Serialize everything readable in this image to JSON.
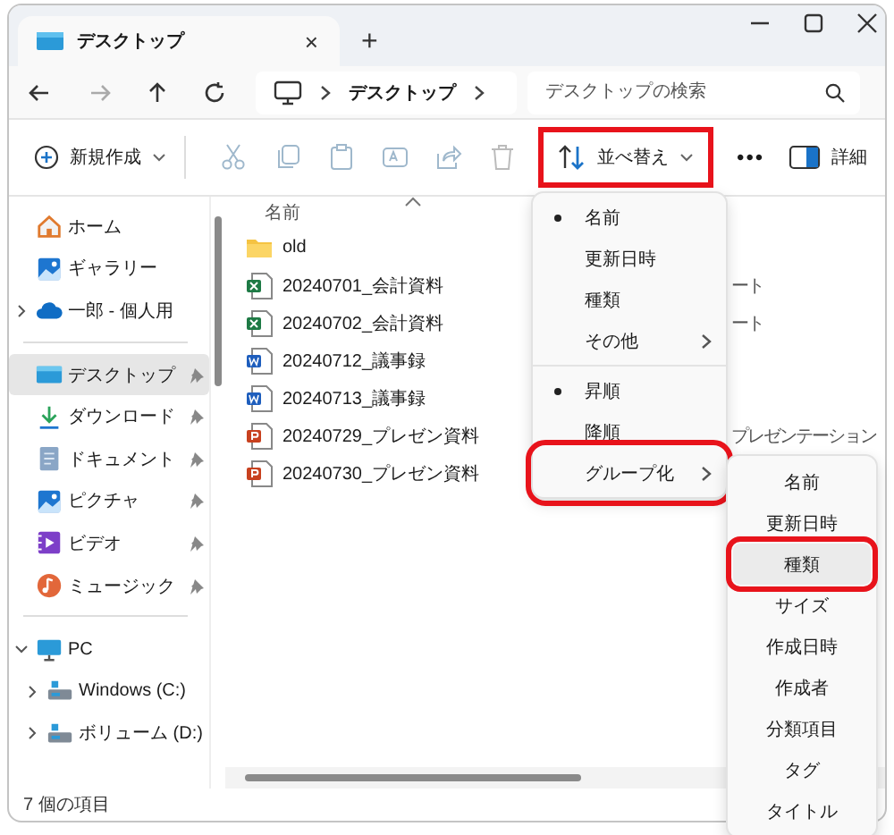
{
  "window": {
    "tab_title": "デスクトップ",
    "tab_close": "×",
    "new_tab": "+"
  },
  "nav": {
    "address": "デスクトップ",
    "search": {
      "placeholder": "デスクトップの検索"
    }
  },
  "toolbar": {
    "new": {
      "label": "新規作成"
    },
    "sort": {
      "label": "並べ替え",
      "highlighted": true
    },
    "more": "•••",
    "details": {
      "label": "詳細"
    }
  },
  "sidebar": {
    "groups": [
      {
        "items": [
          {
            "label": "ホーム",
            "kind": "home",
            "selected": false
          },
          {
            "label": "ギャラリー",
            "kind": "gallery",
            "selected": false
          },
          {
            "label": "一郎 - 個人用",
            "kind": "cloud",
            "selected": false,
            "expanded": false
          }
        ]
      },
      {
        "items": [
          {
            "label": "デスクトップ",
            "kind": "desktop",
            "selected": true,
            "pinned": true
          },
          {
            "label": "ダウンロード",
            "kind": "download",
            "selected": false,
            "pinned": true
          },
          {
            "label": "ドキュメント",
            "kind": "document",
            "selected": false,
            "pinned": true
          },
          {
            "label": "ピクチャ",
            "kind": "gallery",
            "selected": false,
            "pinned": true
          },
          {
            "label": "ビデオ",
            "kind": "video",
            "selected": false,
            "pinned": true
          },
          {
            "label": "ミュージック",
            "kind": "music",
            "selected": false,
            "pinned": true
          }
        ]
      },
      {
        "items": [
          {
            "label": "PC",
            "kind": "pc",
            "selected": false,
            "expanded": true,
            "children": [
              {
                "label": "Windows (C:)",
                "kind": "drive",
                "selected": false,
                "expanded": false
              },
              {
                "label": "ボリューム (D:)",
                "kind": "drive",
                "selected": false,
                "expanded": false
              }
            ]
          }
        ]
      }
    ]
  },
  "files": {
    "columns": [
      "名前"
    ],
    "rows": [
      {
        "name": "old",
        "kind": "folder"
      },
      {
        "name": "20240701_会計資料",
        "kind": "excel",
        "column_2": "ート"
      },
      {
        "name": "20240702_会計資料",
        "kind": "excel",
        "column_2": "ート"
      },
      {
        "name": "20240712_議事録",
        "kind": "word"
      },
      {
        "name": "20240713_議事録",
        "kind": "word"
      },
      {
        "name": "20240729_プレゼン資料",
        "kind": "powerpoint",
        "column_2": "プレゼンテーション"
      },
      {
        "name": "20240730_プレゼン資料",
        "kind": "powerpoint"
      }
    ]
  },
  "sort_menu": {
    "groups": [
      {
        "items": [
          {
            "label": "名前",
            "selected": true
          },
          {
            "label": "更新日時",
            "selected": false
          },
          {
            "label": "種類",
            "selected": false
          },
          {
            "label": "その他",
            "selected": false,
            "submenu": true
          }
        ]
      },
      {
        "items": [
          {
            "label": "昇順",
            "selected": true
          },
          {
            "label": "降順",
            "selected": false
          },
          {
            "label": "グループ化",
            "selected": false,
            "submenu": true,
            "highlighted": true
          }
        ]
      }
    ]
  },
  "group_by_menu": {
    "items": [
      {
        "label": "名前",
        "selected": false,
        "highlighted": false
      },
      {
        "label": "更新日時",
        "selected": false,
        "highlighted": false
      },
      {
        "label": "種類",
        "selected": true,
        "highlighted": true
      },
      {
        "label": "サイズ",
        "selected": false,
        "highlighted": false
      },
      {
        "label": "作成日時",
        "selected": false,
        "highlighted": false
      },
      {
        "label": "作成者",
        "selected": false,
        "highlighted": false
      },
      {
        "label": "分類項目",
        "selected": false,
        "highlighted": false
      },
      {
        "label": "タグ",
        "selected": false,
        "highlighted": false
      },
      {
        "label": "タイトル",
        "selected": false,
        "highlighted": false
      }
    ]
  },
  "status_bar": {
    "count": "7 個の項目"
  }
}
